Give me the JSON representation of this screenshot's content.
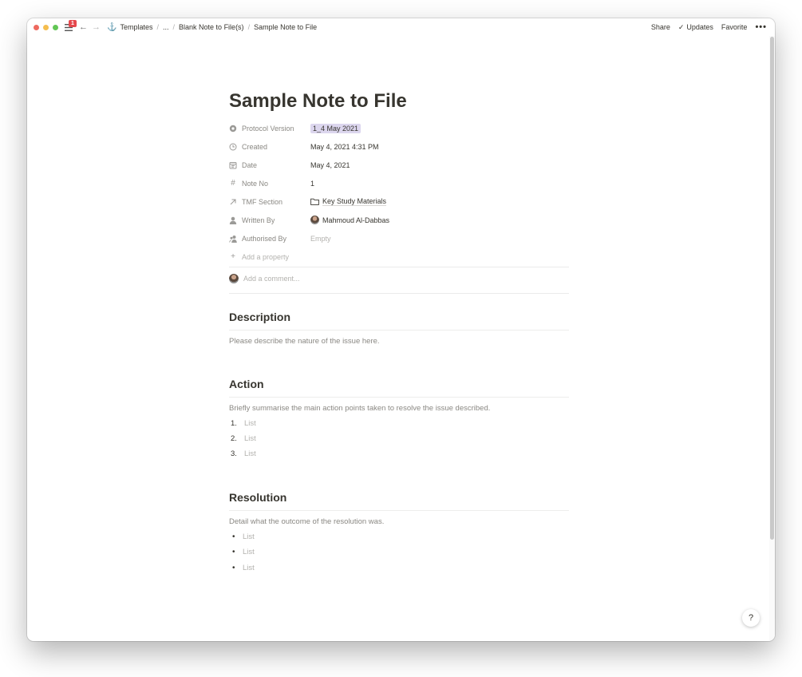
{
  "titlebar": {
    "badge_count": "1",
    "breadcrumbs": [
      "Templates",
      "...",
      "Blank Note to File(s)",
      "Sample Note to File"
    ],
    "actions": {
      "share": "Share",
      "updates": "Updates",
      "favorite": "Favorite",
      "more": "•••"
    }
  },
  "page": {
    "title": "Sample Note to File",
    "properties": [
      {
        "name": "Protocol Version",
        "value": "1_4 May 2021",
        "icon": "gear-icon"
      },
      {
        "name": "Created",
        "value": "May 4, 2021 4:31 PM",
        "icon": "clock-icon"
      },
      {
        "name": "Date",
        "value": "May 4, 2021",
        "icon": "calendar-icon"
      },
      {
        "name": "Note No",
        "value": "1",
        "icon": "hash-icon"
      },
      {
        "name": "TMF Section",
        "value": "Key Study Materials",
        "icon": "relation-arrow-icon"
      },
      {
        "name": "Written By",
        "value": "Mahmoud Al-Dabbas",
        "icon": "person-icon"
      },
      {
        "name": "Authorised By",
        "value": "Empty",
        "icon": "people-icon"
      }
    ],
    "add_property": "Add a property",
    "comment_placeholder": "Add a comment...",
    "sections": {
      "description": {
        "heading": "Description",
        "text": "Please describe the nature of the issue here."
      },
      "action": {
        "heading": "Action",
        "text": "Briefly summarise the main action points taken to resolve the issue described.",
        "numbers": [
          "1.",
          "2.",
          "3."
        ],
        "items": [
          "List",
          "List",
          "List"
        ]
      },
      "resolution": {
        "heading": "Resolution",
        "text": "Detail what the outcome of the resolution was.",
        "items": [
          "List",
          "List",
          "List"
        ]
      }
    }
  },
  "help": "?",
  "colors": {
    "tag_bg": "#dcd6ee",
    "text": "#37352f",
    "muted": "#8a8883",
    "badge": "#e5484d"
  }
}
